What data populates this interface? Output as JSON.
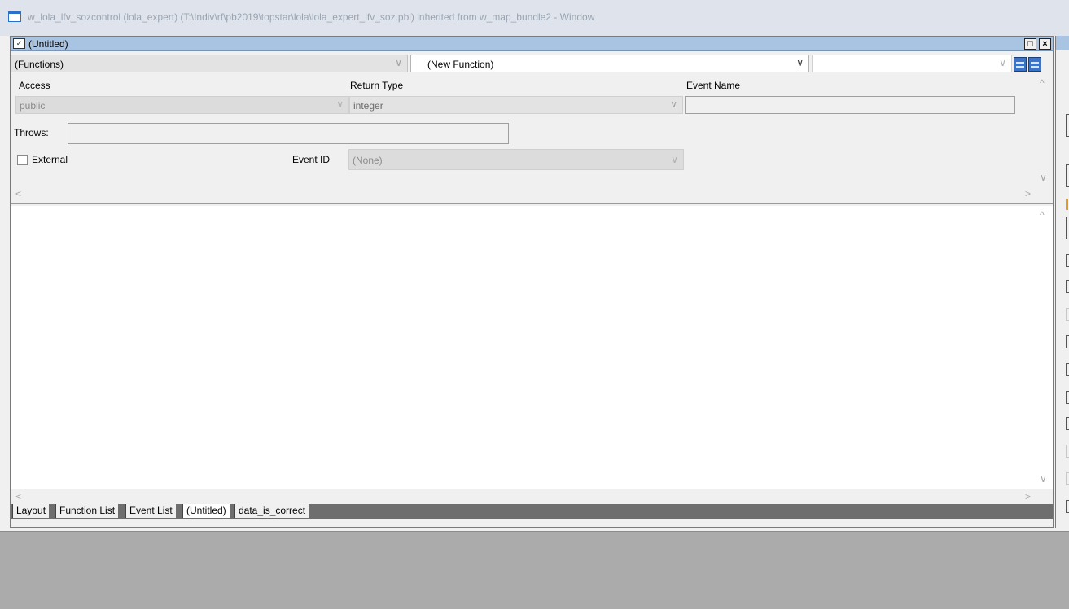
{
  "window": {
    "title": "w_lola_lfv_sozcontrol (lola_expert) (T:\\Indiv\\rf\\pb2019\\topstar\\lola\\lola_expert_lfv_soz.pbl) inherited from w_map_bundle2 - Window"
  },
  "child": {
    "title": "(Untitled)",
    "maximize_glyph": "□",
    "close_glyph": "×"
  },
  "toolbar": {
    "object_combo": "(Functions)",
    "function_combo": "(New Function)",
    "third_combo": ""
  },
  "declaration": {
    "access_label": "Access",
    "access_value": "public",
    "return_type_label": "Return Type",
    "return_type_value": "integer",
    "event_name_label": "Event Name",
    "event_name_value": "",
    "throws_label": "Throws:",
    "throws_value": "",
    "external_label": "External",
    "external_checked": false,
    "event_id_label": "Event ID",
    "event_id_value": "(None)"
  },
  "tabs": [
    {
      "label": "Layout",
      "active": false
    },
    {
      "label": "Function List",
      "active": false
    },
    {
      "label": "Event List",
      "active": false
    },
    {
      "label": "(Untitled)",
      "active": true
    },
    {
      "label": "data_is_correct",
      "active": false
    }
  ],
  "glyphs": {
    "combo_arrow": "∨",
    "scroll_up": "^",
    "scroll_down": "∨",
    "scroll_left": "<",
    "scroll_right": ">"
  },
  "colors": {
    "child_title_bar": "#a9c4e3",
    "view_button": "#3a73c8",
    "sliver_accent": "#e39b1f"
  }
}
